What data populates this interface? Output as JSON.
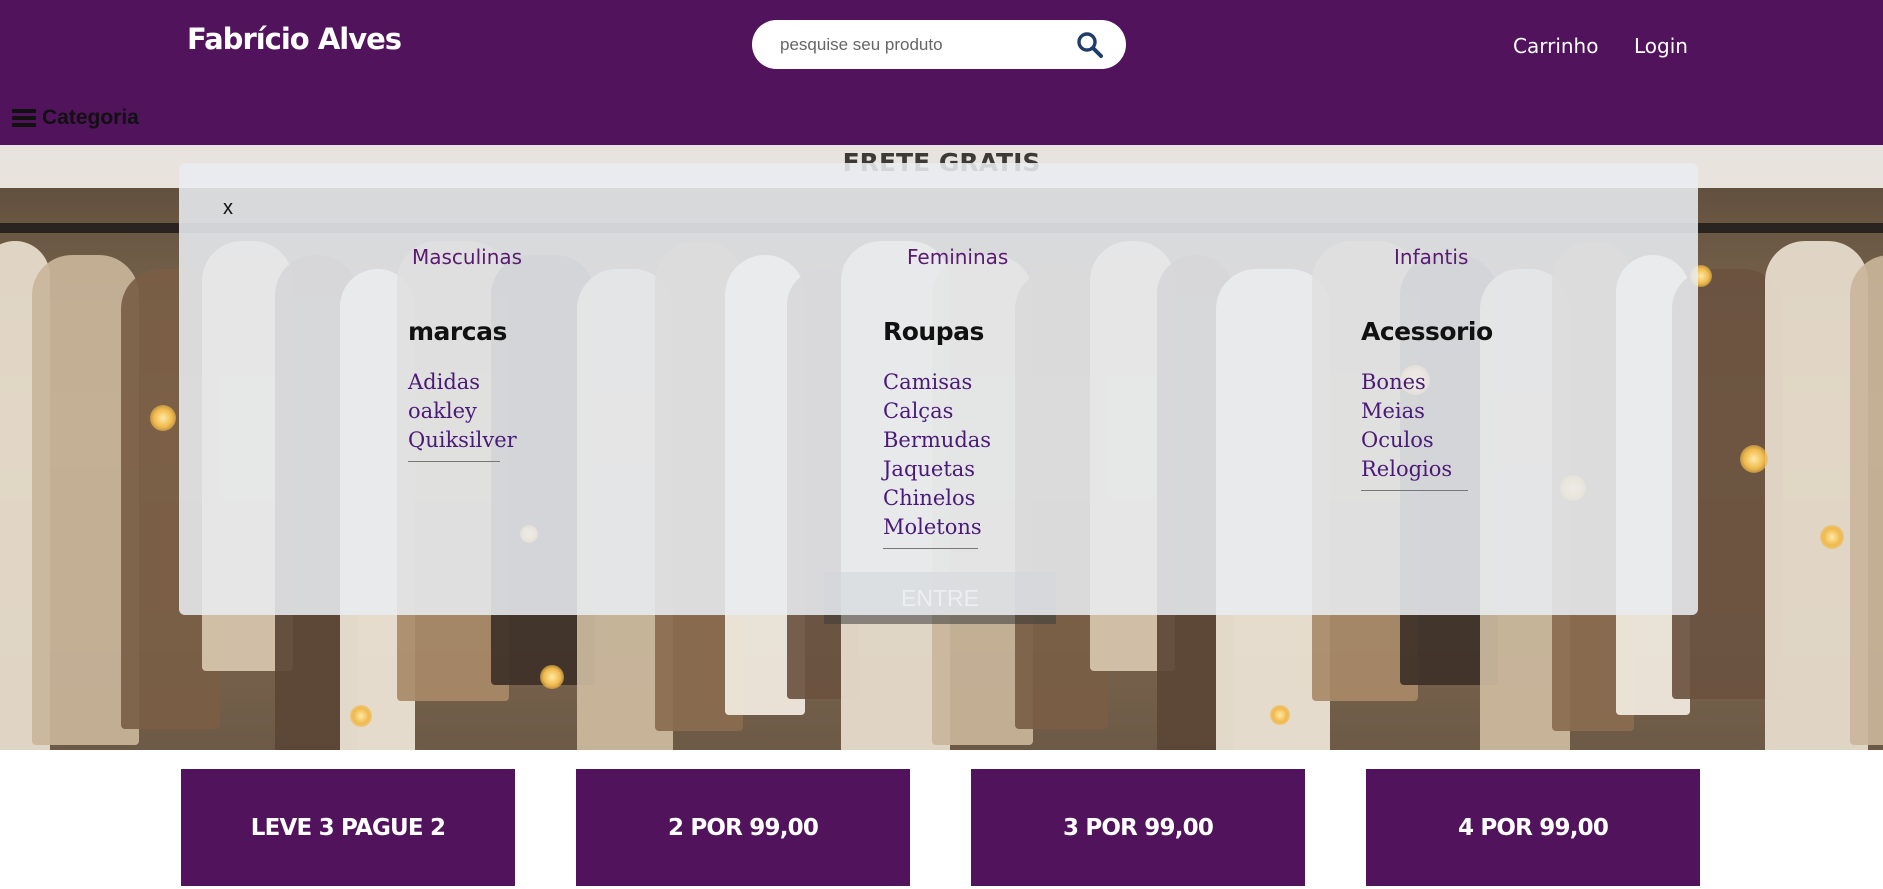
{
  "header": {
    "brand": "Fabrício Alves",
    "search_placeholder": "pesquise seu produto",
    "cart_label": "Carrinho",
    "login_label": "Login",
    "category_label": "Categoria"
  },
  "banner": {
    "title": "FRETE GRATIS",
    "button_label": "ENTRE"
  },
  "menu": {
    "close_label": "x",
    "tabs": [
      "Masculinas",
      "Femininas",
      "Infantis"
    ],
    "columns": [
      {
        "heading": "marcas",
        "items": [
          "Adidas",
          "oakley",
          "Quiksilver"
        ]
      },
      {
        "heading": "Roupas",
        "items": [
          "Camisas",
          "Calças",
          "Bermudas",
          "Jaquetas",
          "Chinelos",
          "Moletons"
        ]
      },
      {
        "heading": "Acessorio",
        "items": [
          "Bones",
          "Meias",
          "Oculos",
          "Relogios"
        ]
      }
    ]
  },
  "promos": [
    "LEVE 3 PAGUE 2",
    "2 POR 99,00",
    "3 POR 99,00",
    "4 POR 99,00"
  ],
  "colors": {
    "brand_purple": "#51135c",
    "link_purple": "#4a1a78"
  }
}
